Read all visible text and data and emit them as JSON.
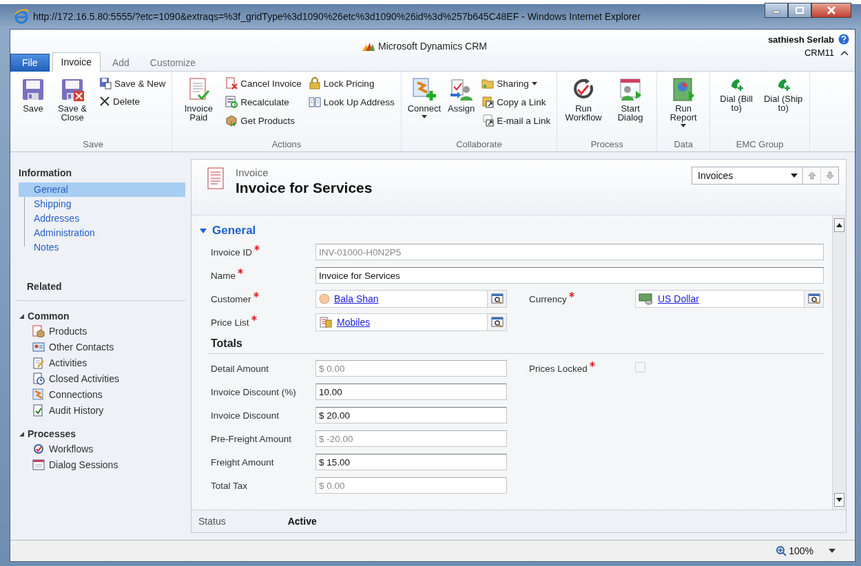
{
  "window": {
    "title": "http://172.16.5.80:5555/?etc=1090&extraqs=%3f_gridType%3d1090%26etc%3d1090%26id%3d%257b645C48EF - Windows Internet Explorer"
  },
  "header": {
    "product": "Microsoft Dynamics CRM",
    "user": "sathiesh Serlab",
    "organization": "CRM11"
  },
  "tabs": [
    {
      "label": "File",
      "kind": "file",
      "selected": false
    },
    {
      "label": "Invoice",
      "kind": "tab",
      "selected": true
    },
    {
      "label": "Add",
      "kind": "tab",
      "selected": false
    },
    {
      "label": "Customize",
      "kind": "tab",
      "selected": false
    }
  ],
  "ribbon_groups": [
    {
      "label": "Save",
      "buttons": [
        {
          "label": "Save",
          "kind": "large",
          "dropdown": false
        },
        {
          "label": "Save & Close",
          "kind": "large",
          "dropdown": false
        },
        {
          "label": "Save & New",
          "kind": "small",
          "dropdown": false
        },
        {
          "label": "Delete",
          "kind": "small",
          "dropdown": false
        }
      ]
    },
    {
      "label": "Actions",
      "buttons": [
        {
          "label": "Invoice Paid",
          "kind": "large",
          "dropdown": false
        },
        {
          "label": "Cancel Invoice",
          "kind": "small",
          "dropdown": false
        },
        {
          "label": "Recalculate",
          "kind": "small",
          "dropdown": false
        },
        {
          "label": "Get Products",
          "kind": "small",
          "dropdown": false
        },
        {
          "label": "Lock Pricing",
          "kind": "small",
          "dropdown": false
        },
        {
          "label": "Look Up Address",
          "kind": "small",
          "dropdown": false
        }
      ]
    },
    {
      "label": "Collaborate",
      "buttons": [
        {
          "label": "Connect",
          "kind": "large",
          "dropdown": true
        },
        {
          "label": "Assign",
          "kind": "large",
          "dropdown": false
        },
        {
          "label": "Sharing",
          "kind": "small",
          "dropdown": true
        },
        {
          "label": "Copy a Link",
          "kind": "small",
          "dropdown": false
        },
        {
          "label": "E-mail a Link",
          "kind": "small",
          "dropdown": false
        }
      ]
    },
    {
      "label": "Process",
      "buttons": [
        {
          "label": "Run Workflow",
          "kind": "large",
          "dropdown": false
        },
        {
          "label": "Start Dialog",
          "kind": "large",
          "dropdown": false
        }
      ]
    },
    {
      "label": "Data",
      "buttons": [
        {
          "label": "Run Report",
          "kind": "large",
          "dropdown": true
        }
      ]
    },
    {
      "label": "EMC Group",
      "buttons": [
        {
          "label": "Dial (Bill to)",
          "kind": "large",
          "dropdown": false
        },
        {
          "label": "Dial (Ship to)",
          "kind": "large",
          "dropdown": false
        }
      ]
    }
  ],
  "navigation": {
    "title": "Information",
    "items": [
      {
        "label": "General",
        "selected": true
      },
      {
        "label": "Shipping",
        "selected": false
      },
      {
        "label": "Addresses",
        "selected": false
      },
      {
        "label": "Administration",
        "selected": false
      },
      {
        "label": "Notes",
        "selected": false
      }
    ],
    "related_title": "Related",
    "groups": [
      {
        "label": "Common",
        "expanded": true,
        "items": [
          "Products",
          "Other Contacts",
          "Activities",
          "Closed Activities",
          "Connections",
          "Audit History"
        ]
      },
      {
        "label": "Processes",
        "expanded": true,
        "items": [
          "Workflows",
          "Dialog Sessions"
        ]
      }
    ]
  },
  "form": {
    "entity": "Invoice",
    "title": "Invoice for Services",
    "record_set": "Invoices",
    "sections": [
      {
        "title": "General",
        "kind": "collapsible",
        "expanded": true,
        "rows": [
          {
            "kind": "wide",
            "fields": [
              {
                "label": "Invoice ID",
                "required": true,
                "kind": "text",
                "value": "INV-01000-H0N2P5",
                "disabled": true
              }
            ]
          },
          {
            "kind": "wide",
            "fields": [
              {
                "label": "Name",
                "required": true,
                "kind": "text",
                "value": "Invoice for Services",
                "disabled": false
              }
            ]
          },
          {
            "kind": "columns",
            "fields": [
              {
                "label": "Customer",
                "required": true,
                "kind": "lookup",
                "value": "Bala Shan"
              },
              {
                "label": "Currency",
                "required": true,
                "kind": "lookup",
                "value": "US Dollar"
              }
            ]
          },
          {
            "kind": "columns",
            "fields": [
              {
                "label": "Price List",
                "required": true,
                "kind": "lookup",
                "value": "Mobiles"
              }
            ]
          }
        ]
      },
      {
        "title": "Totals",
        "kind": "plain",
        "rows": [
          {
            "kind": "columns",
            "fields": [
              {
                "label": "Detail Amount",
                "required": false,
                "kind": "text",
                "value": "$ 0.00",
                "disabled": true
              },
              {
                "label": "Prices Locked",
                "required": true,
                "kind": "checkbox",
                "checked": false
              }
            ]
          },
          {
            "kind": "columns",
            "fields": [
              {
                "label": "Invoice Discount (%)",
                "required": false,
                "kind": "text",
                "value": "10.00",
                "disabled": false
              }
            ]
          },
          {
            "kind": "columns",
            "fields": [
              {
                "label": "Invoice Discount",
                "required": false,
                "kind": "text",
                "value": "$ 20.00",
                "disabled": false
              }
            ]
          },
          {
            "kind": "columns",
            "fields": [
              {
                "label": "Pre-Freight Amount",
                "required": false,
                "kind": "text",
                "value": "$ -20.00",
                "disabled": true
              }
            ]
          },
          {
            "kind": "columns",
            "fields": [
              {
                "label": "Freight Amount",
                "required": false,
                "kind": "text",
                "value": "$ 15.00",
                "disabled": false
              }
            ]
          },
          {
            "kind": "columns",
            "fields": [
              {
                "label": "Total Tax",
                "required": false,
                "kind": "text",
                "value": "$ 0.00",
                "disabled": true
              }
            ]
          }
        ]
      }
    ],
    "footer": {
      "label": "Status",
      "value": "Active"
    }
  },
  "status_bar": {
    "zoom": "100%"
  }
}
